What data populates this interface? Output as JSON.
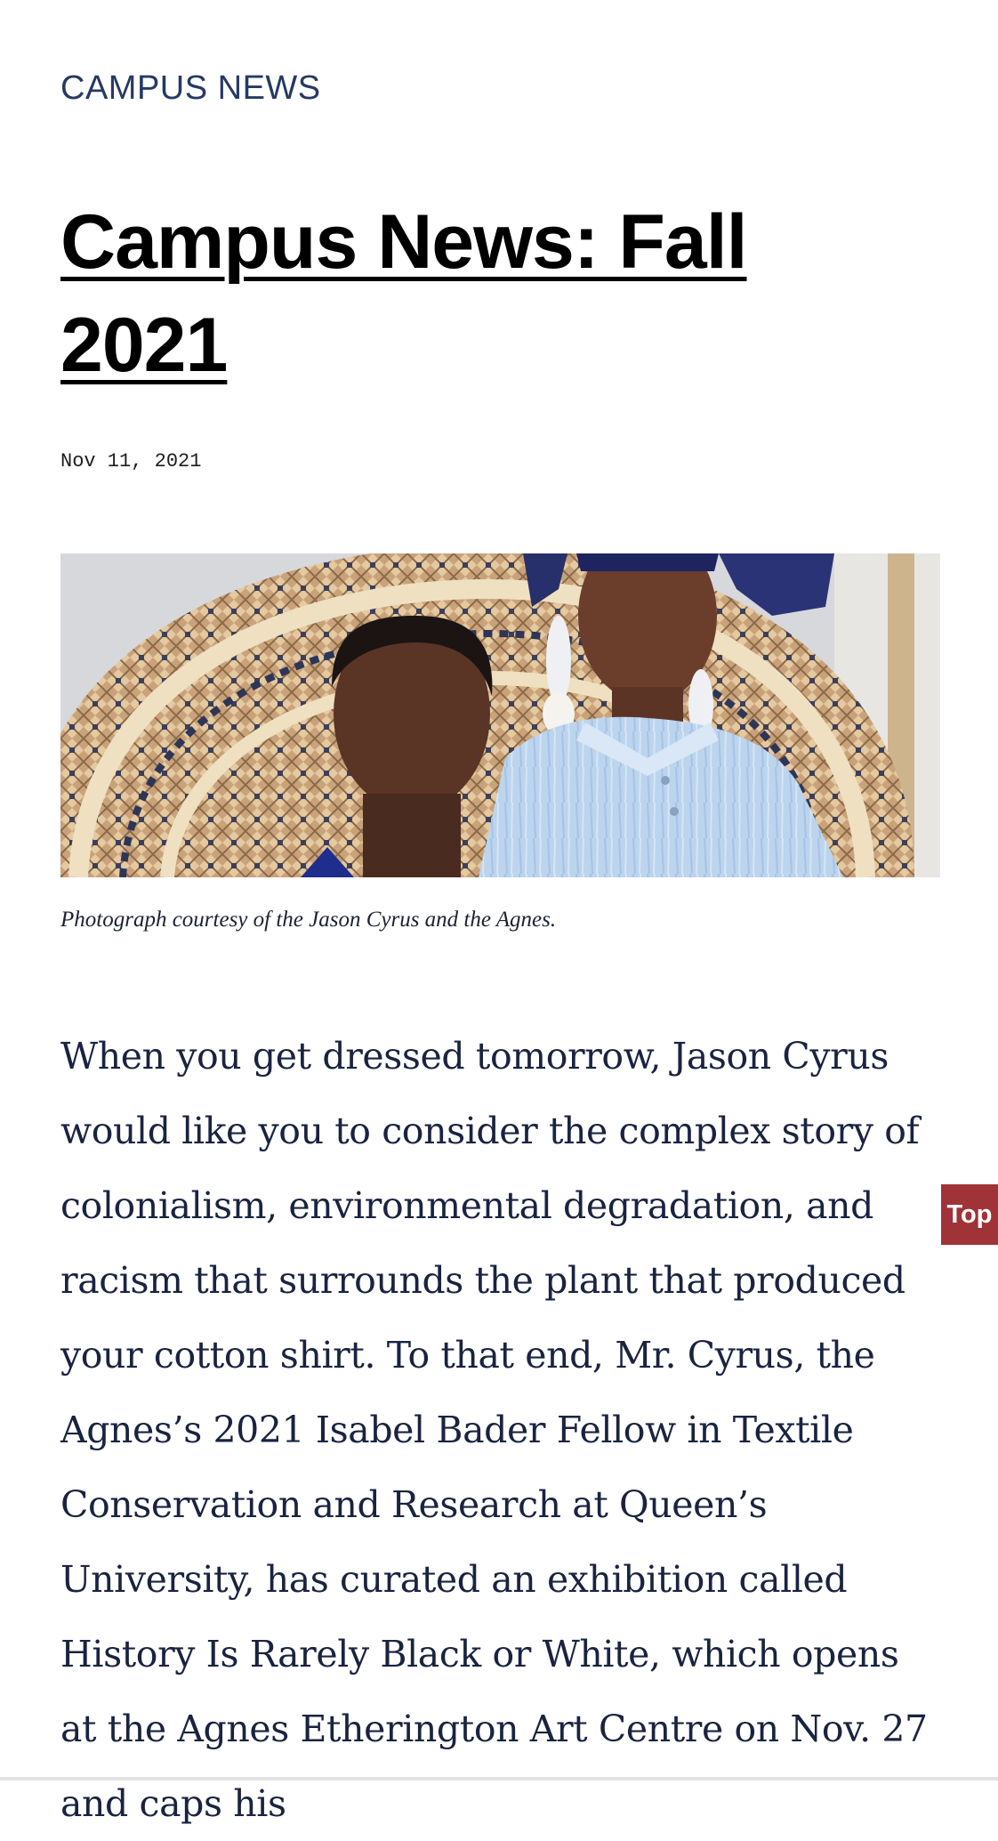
{
  "section": {
    "label": "CAMPUS NEWS"
  },
  "article": {
    "title": "Campus News: Fall 2021",
    "date": "Nov 11, 2021",
    "image_caption": "Photograph courtesy of the Jason Cyrus and the Agnes.",
    "body": "When you get dressed tomorrow, Jason Cyrus would like you to consider the complex story of colonialism, environmental degradation, and racism that surrounds the plant that produced your cotton shirt. To that end, Mr. Cyrus, the Agnes’s 2021 Isabel Bader Fellow in Textile Conservation and Research at Queen’s University, has curated an exhibition called History Is Rarely Black or White, which opens at the Agnes Etherington Art Centre on Nov. 27 and caps his"
  },
  "controls": {
    "top_label": "Top"
  },
  "colors": {
    "section_label": "#253a63",
    "body_text": "#1a2340",
    "top_button": "#9f3338"
  }
}
